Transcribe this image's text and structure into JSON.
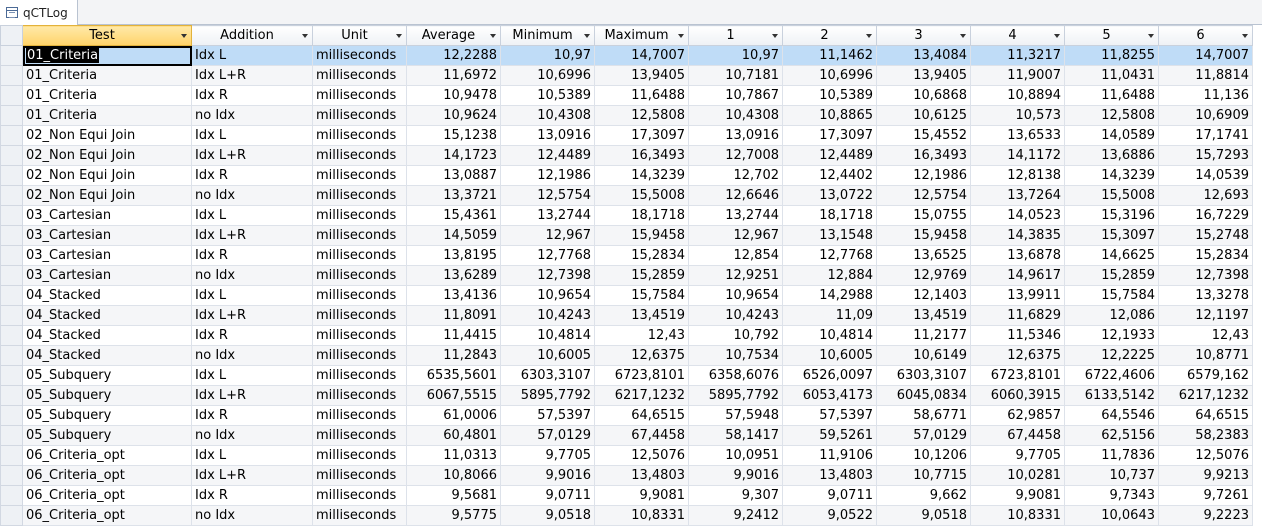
{
  "window": {
    "tab_title": "qCTLog"
  },
  "columns": [
    "Test",
    "Addition",
    "Unit",
    "Average",
    "Minimum",
    "Maximum",
    "1",
    "2",
    "3",
    "4",
    "5",
    "6"
  ],
  "rows": [
    [
      "01_Criteria",
      "Idx L",
      "milliseconds",
      "12,2288",
      "10,97",
      "14,7007",
      "10,97",
      "11,1462",
      "13,4084",
      "11,3217",
      "11,8255",
      "14,7007"
    ],
    [
      "01_Criteria",
      "Idx L+R",
      "milliseconds",
      "11,6972",
      "10,6996",
      "13,9405",
      "10,7181",
      "10,6996",
      "13,9405",
      "11,9007",
      "11,0431",
      "11,8814"
    ],
    [
      "01_Criteria",
      "Idx R",
      "milliseconds",
      "10,9478",
      "10,5389",
      "11,6488",
      "10,7867",
      "10,5389",
      "10,6868",
      "10,8894",
      "11,6488",
      "11,136"
    ],
    [
      "01_Criteria",
      "no Idx",
      "milliseconds",
      "10,9624",
      "10,4308",
      "12,5808",
      "10,4308",
      "10,8865",
      "10,6125",
      "10,573",
      "12,5808",
      "10,6909"
    ],
    [
      "02_Non Equi Join",
      "Idx L",
      "milliseconds",
      "15,1238",
      "13,0916",
      "17,3097",
      "13,0916",
      "17,3097",
      "15,4552",
      "13,6533",
      "14,0589",
      "17,1741"
    ],
    [
      "02_Non Equi Join",
      "Idx L+R",
      "milliseconds",
      "14,1723",
      "12,4489",
      "16,3493",
      "12,7008",
      "12,4489",
      "16,3493",
      "14,1172",
      "13,6886",
      "15,7293"
    ],
    [
      "02_Non Equi Join",
      "Idx R",
      "milliseconds",
      "13,0887",
      "12,1986",
      "14,3239",
      "12,702",
      "12,4402",
      "12,1986",
      "12,8138",
      "14,3239",
      "14,0539"
    ],
    [
      "02_Non Equi Join",
      "no Idx",
      "milliseconds",
      "13,3721",
      "12,5754",
      "15,5008",
      "12,6646",
      "13,0722",
      "12,5754",
      "13,7264",
      "15,5008",
      "12,693"
    ],
    [
      "03_Cartesian",
      "Idx L",
      "milliseconds",
      "15,4361",
      "13,2744",
      "18,1718",
      "13,2744",
      "18,1718",
      "15,0755",
      "14,0523",
      "15,3196",
      "16,7229"
    ],
    [
      "03_Cartesian",
      "Idx L+R",
      "milliseconds",
      "14,5059",
      "12,967",
      "15,9458",
      "12,967",
      "13,1548",
      "15,9458",
      "14,3835",
      "15,3097",
      "15,2748"
    ],
    [
      "03_Cartesian",
      "Idx R",
      "milliseconds",
      "13,8195",
      "12,7768",
      "15,2834",
      "12,854",
      "12,7768",
      "13,6525",
      "13,6878",
      "14,6625",
      "15,2834"
    ],
    [
      "03_Cartesian",
      "no Idx",
      "milliseconds",
      "13,6289",
      "12,7398",
      "15,2859",
      "12,9251",
      "12,884",
      "12,9769",
      "14,9617",
      "15,2859",
      "12,7398"
    ],
    [
      "04_Stacked",
      "Idx L",
      "milliseconds",
      "13,4136",
      "10,9654",
      "15,7584",
      "10,9654",
      "14,2988",
      "12,1403",
      "13,9911",
      "15,7584",
      "13,3278"
    ],
    [
      "04_Stacked",
      "Idx L+R",
      "milliseconds",
      "11,8091",
      "10,4243",
      "13,4519",
      "10,4243",
      "11,09",
      "13,4519",
      "11,6829",
      "12,086",
      "12,1197"
    ],
    [
      "04_Stacked",
      "Idx R",
      "milliseconds",
      "11,4415",
      "10,4814",
      "12,43",
      "10,792",
      "10,4814",
      "11,2177",
      "11,5346",
      "12,1933",
      "12,43"
    ],
    [
      "04_Stacked",
      "no Idx",
      "milliseconds",
      "11,2843",
      "10,6005",
      "12,6375",
      "10,7534",
      "10,6005",
      "10,6149",
      "12,6375",
      "12,2225",
      "10,8771"
    ],
    [
      "05_Subquery",
      "Idx L",
      "milliseconds",
      "6535,5601",
      "6303,3107",
      "6723,8101",
      "6358,6076",
      "6526,0097",
      "6303,3107",
      "6723,8101",
      "6722,4606",
      "6579,162"
    ],
    [
      "05_Subquery",
      "Idx L+R",
      "milliseconds",
      "6067,5515",
      "5895,7792",
      "6217,1232",
      "5895,7792",
      "6053,4173",
      "6045,0834",
      "6060,3915",
      "6133,5142",
      "6217,1232"
    ],
    [
      "05_Subquery",
      "Idx R",
      "milliseconds",
      "61,0006",
      "57,5397",
      "64,6515",
      "57,5948",
      "57,5397",
      "58,6771",
      "62,9857",
      "64,5546",
      "64,6515"
    ],
    [
      "05_Subquery",
      "no Idx",
      "milliseconds",
      "60,4801",
      "57,0129",
      "67,4458",
      "58,1417",
      "59,5261",
      "57,0129",
      "67,4458",
      "62,5156",
      "58,2383"
    ],
    [
      "06_Criteria_opt",
      "Idx L",
      "milliseconds",
      "11,0313",
      "9,7705",
      "12,5076",
      "10,0951",
      "11,9106",
      "10,1206",
      "9,7705",
      "11,7836",
      "12,5076"
    ],
    [
      "06_Criteria_opt",
      "Idx L+R",
      "milliseconds",
      "10,8066",
      "9,9016",
      "13,4803",
      "9,9016",
      "13,4803",
      "10,7715",
      "10,0281",
      "10,737",
      "9,9213"
    ],
    [
      "06_Criteria_opt",
      "Idx R",
      "milliseconds",
      "9,5681",
      "9,0711",
      "9,9081",
      "9,307",
      "9,0711",
      "9,662",
      "9,9081",
      "9,7343",
      "9,7261"
    ],
    [
      "06_Criteria_opt",
      "no Idx",
      "milliseconds",
      "9,5775",
      "9,0518",
      "10,8331",
      "9,2412",
      "9,0522",
      "9,0518",
      "10,8331",
      "10,0643",
      "9,2223"
    ]
  ]
}
